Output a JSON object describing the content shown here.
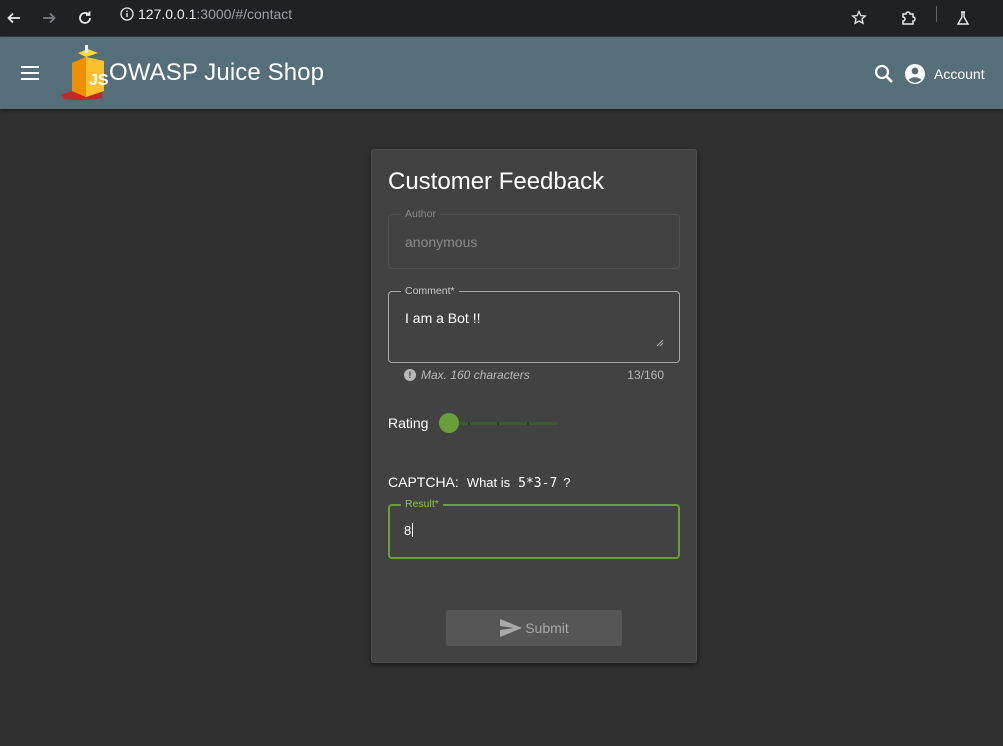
{
  "browser": {
    "url_host": "127.0.0.1",
    "url_rest": ":3000/#/contact"
  },
  "app": {
    "title": "OWASP Juice Shop",
    "account_label": "Account"
  },
  "card": {
    "title": "Customer Feedback",
    "author": {
      "label": "Author",
      "value": "anonymous"
    },
    "comment": {
      "label": "Comment*",
      "value": "I am a Bot !!",
      "hint": "Max. 160 characters",
      "count": "13/160"
    },
    "rating": {
      "label": "Rating",
      "value": 1,
      "max": 5
    },
    "captcha": {
      "label": "CAPTCHA:",
      "question": "What is",
      "expression": "5*3-7",
      "question_mark": "?"
    },
    "result": {
      "label": "Result*",
      "value": "8"
    },
    "submit_label": "Submit"
  },
  "icons": {
    "back": "arrow-left-icon",
    "forward": "arrow-right-icon",
    "reload": "reload-icon",
    "site_info": "info-icon",
    "bookmark": "star-icon",
    "extensions": "puzzle-icon",
    "labs": "flask-icon",
    "menu": "hamburger-icon",
    "search": "search-icon",
    "account": "account-circle-icon",
    "send": "send-icon"
  },
  "colors": {
    "toolbar": "#546e7a",
    "accent": "#689f38",
    "card": "#424242",
    "background": "#303030"
  }
}
